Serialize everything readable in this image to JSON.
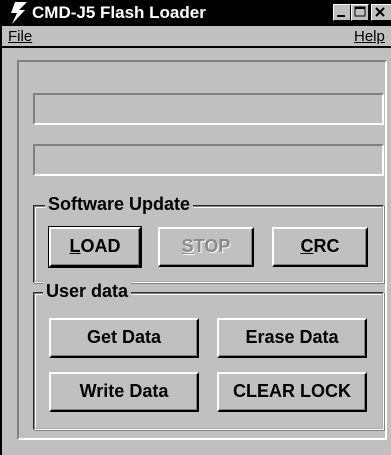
{
  "window": {
    "title": "CMD-J5  Flash Loader",
    "icon": "lightning-bolt-icon",
    "controls": [
      "minimize-icon",
      "maximize-icon",
      "close-icon"
    ]
  },
  "menu": {
    "file": "File",
    "help": "Help"
  },
  "status": {
    "line1": "",
    "line2": ""
  },
  "software_update": {
    "label": "Software Update",
    "load": {
      "accel": "L",
      "rest": "OAD"
    },
    "stop": {
      "accel": "S",
      "rest": "TOP"
    },
    "crc": {
      "accel": "C",
      "rest": "RC"
    }
  },
  "user_data": {
    "label": "User data",
    "get": "Get Data",
    "erase": "Erase Data",
    "write": "Write Data",
    "clear_lock": "CLEAR LOCK"
  },
  "colors": {
    "face": "#c0c0c0",
    "titlebar": "#000000",
    "disabled_text": "#8a8a8a"
  }
}
